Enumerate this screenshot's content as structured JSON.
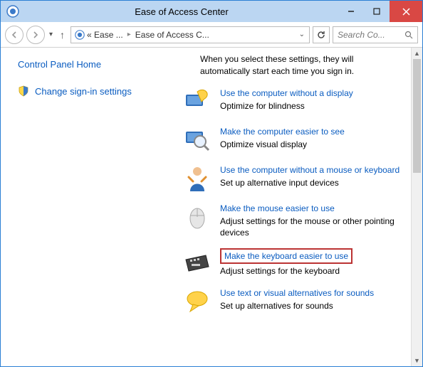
{
  "window": {
    "title": "Ease of Access Center"
  },
  "breadcrumb": {
    "a": "« Ease ...",
    "b": "Ease of Access C..."
  },
  "search": {
    "placeholder": "Search Co..."
  },
  "sidebar": {
    "home": "Control Panel Home",
    "signin": "Change sign-in settings"
  },
  "intro": "When you select these settings, they will automatically start each time you sign in.",
  "options": [
    {
      "link": "Use the computer without a display",
      "desc": "Optimize for blindness"
    },
    {
      "link": "Make the computer easier to see",
      "desc": "Optimize visual display"
    },
    {
      "link": "Use the computer without a mouse or keyboard",
      "desc": "Set up alternative input devices"
    },
    {
      "link": "Make the mouse easier to use",
      "desc": "Adjust settings for the mouse or other pointing devices"
    },
    {
      "link": "Make the keyboard easier to use",
      "desc": "Adjust settings for the keyboard"
    },
    {
      "link": "Use text or visual alternatives for sounds",
      "desc": "Set up alternatives for sounds"
    }
  ]
}
